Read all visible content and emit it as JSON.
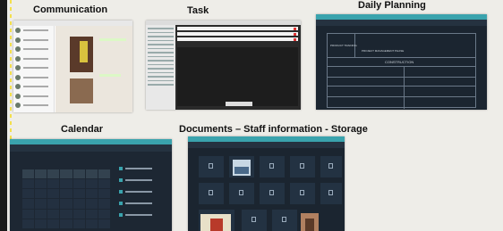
{
  "sections": {
    "communication": "Communication",
    "task": "Task",
    "daily_planning": "Daily Planning",
    "calendar": "Calendar",
    "documents": "Documents – Staff information - Storage"
  },
  "daily_planning_form": {
    "site_label": "PRODUCT TRAINING",
    "project_line": "PROJECT MANAGEMENT PHASE",
    "heading": "CONSTRUCTION"
  },
  "colors": {
    "accent_teal": "#3aa3ad",
    "dark_panel": "#1b2530",
    "sidebar_stripe": "#1a1a1a",
    "stripe_dots": "#f4e04d"
  }
}
